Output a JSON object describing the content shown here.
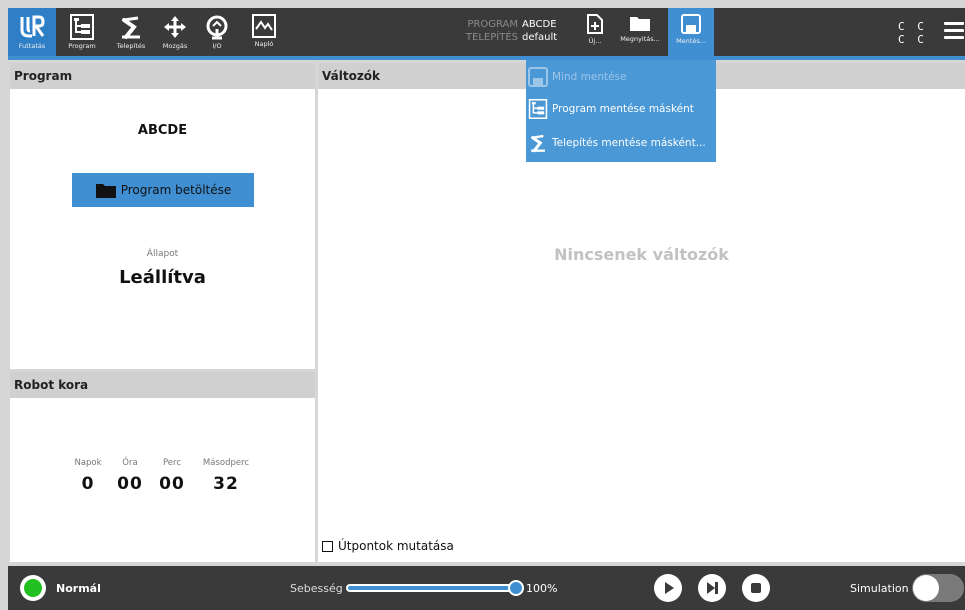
{
  "nav": {
    "run": "Futtatás",
    "program": "Program",
    "install": "Telepítés",
    "move": "Mozgás",
    "io": "I/O",
    "log": "Napló"
  },
  "program_info": {
    "program_key": "PROGRAM",
    "program_value": "ABCDE",
    "install_key": "TELEPÍTÉS",
    "install_value": "default"
  },
  "file_actions": {
    "new": "Új...",
    "open": "Megnyitás...",
    "save": "Mentés..."
  },
  "cc_indicator": {
    "line1": "C C",
    "line2": "C C"
  },
  "save_menu": {
    "save_all": "Mind mentése",
    "save_program_as": "Program mentése másként",
    "save_install_as": "Telepítés mentése másként..."
  },
  "program_panel": {
    "title": "Program",
    "program_name": "ABCDE",
    "load_button": "Program betöltése",
    "state_caption": "Állapot",
    "state_value": "Leállítva"
  },
  "robot_age": {
    "title": "Robot kora",
    "days_label": "Napok",
    "days": "0",
    "hours_label": "Óra",
    "hours": "00",
    "minutes_label": "Perc",
    "minutes": "00",
    "seconds_label": "Másodperc",
    "seconds": "32"
  },
  "variables_panel": {
    "title": "Változók",
    "empty_text": "Nincsenek változók",
    "show_waypoints": "Útpontok mutatása",
    "show_waypoints_checked": false
  },
  "footer": {
    "status": "Normál",
    "speed_label": "Sebesség",
    "speed_value": "100%",
    "speed_fraction": 1.0,
    "simulation_label": "Simulation",
    "simulation_on": false
  },
  "colors": {
    "accent": "#3f8fd2",
    "topbar": "#3a3a3a",
    "status_ok": "#22c020"
  },
  "icons": [
    "ur-logo-icon",
    "program-tree-icon",
    "robot-arm-icon",
    "move-arrows-icon",
    "io-icon",
    "log-chart-icon",
    "new-file-icon",
    "folder-icon",
    "save-disk-icon",
    "hamburger-icon",
    "play-icon",
    "step-icon",
    "stop-icon"
  ]
}
